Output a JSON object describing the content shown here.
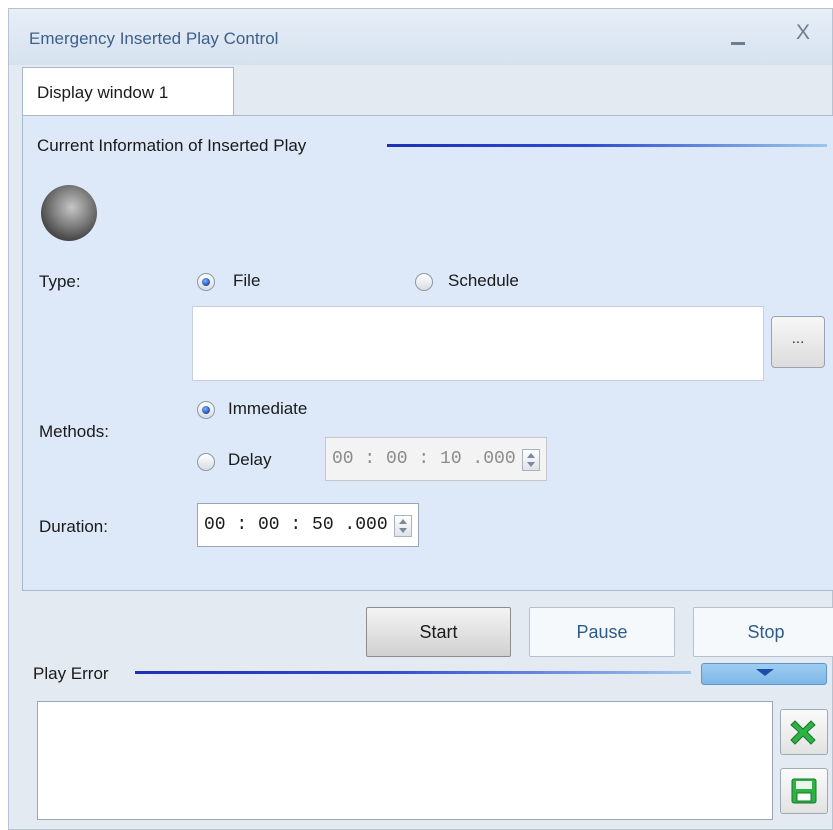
{
  "window": {
    "title": "Emergency Inserted Play Control",
    "close_label": "X"
  },
  "tabs": [
    {
      "label": "Display window 1",
      "active": true
    }
  ],
  "current_info": {
    "section_title": "Current Information of Inserted Play",
    "type": {
      "label": "Type:",
      "options": [
        {
          "label": "File",
          "checked": true
        },
        {
          "label": "Schedule",
          "checked": false
        }
      ],
      "file_value": "",
      "browse_label": "..."
    },
    "methods": {
      "label": "Methods:",
      "options": [
        {
          "label": "Immediate",
          "checked": true
        },
        {
          "label": "Delay",
          "checked": false
        }
      ],
      "delay_value": "00 : 00 : 10 .000"
    },
    "duration": {
      "label": "Duration:",
      "value": "00 : 00 : 50 .000"
    }
  },
  "controls": {
    "start_label": "Start",
    "pause_label": "Pause",
    "stop_label": "Stop"
  },
  "play_error": {
    "section_title": "Play Error",
    "log_value": ""
  },
  "colors": {
    "accent": "#1f2fb8",
    "panel_background": "#dde9f8",
    "title_text": "#3d5f8a"
  },
  "icons": {
    "status": "status-indicator-icon",
    "clear": "clear-x-icon",
    "save": "save-disk-icon"
  }
}
